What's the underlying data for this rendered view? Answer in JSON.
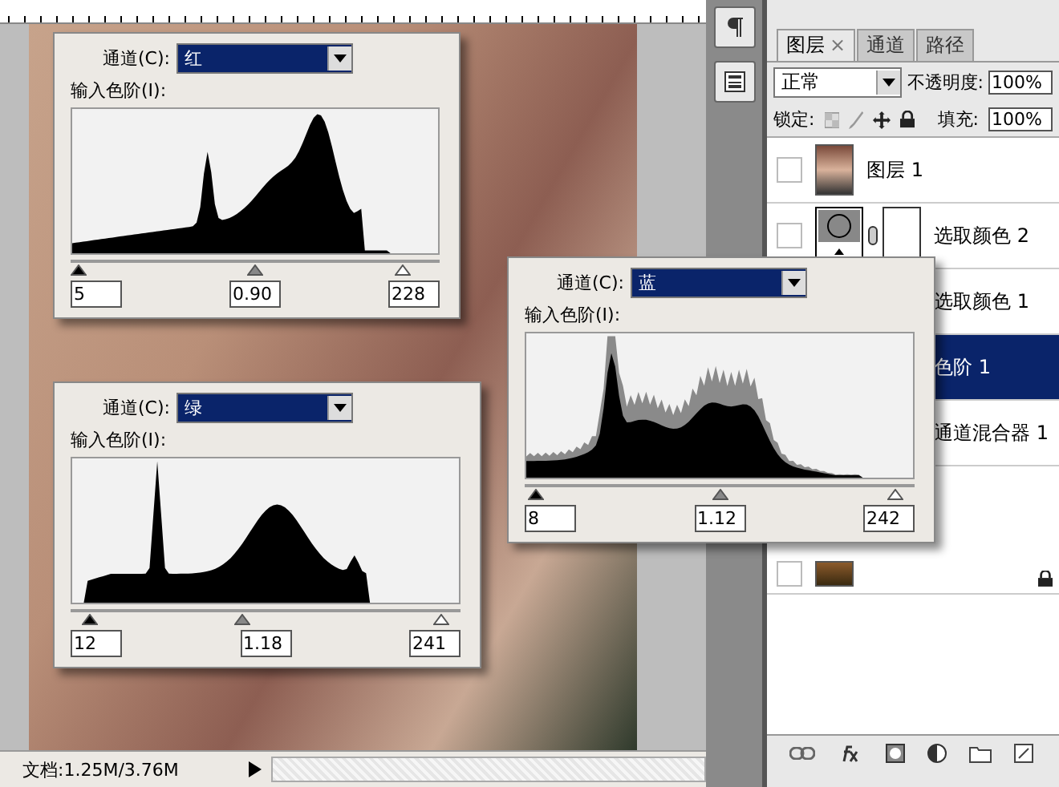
{
  "levels_dialogs": [
    {
      "kind": "red",
      "channel_label": "通道(C):",
      "channel": "红",
      "input_label": "输入色阶(I):",
      "black": "5",
      "gamma": "0.90",
      "white": "228",
      "sliders": [
        {
          "level": 0.02
        },
        {
          "level": 0.5
        },
        {
          "level": 0.9
        }
      ]
    },
    {
      "kind": "green",
      "channel_label": "通道(C):",
      "channel": "绿",
      "input_label": "输入色阶(I):",
      "black": "12",
      "gamma": "1.18",
      "white": "241",
      "sliders": [
        {
          "level": 0.05
        },
        {
          "level": 0.44
        },
        {
          "level": 0.95
        }
      ]
    },
    {
      "kind": "blue",
      "channel_label": "通道(C):",
      "channel": "蓝",
      "input_label": "输入色阶(I):",
      "black": "8",
      "gamma": "1.12",
      "white": "242",
      "sliders": [
        {
          "level": 0.03
        },
        {
          "level": 0.5
        },
        {
          "level": 0.95
        }
      ]
    }
  ],
  "layers_panel": {
    "tabs": [
      {
        "label": "图层",
        "close": "×",
        "selected": true
      },
      {
        "label": "通道",
        "selected": false
      },
      {
        "label": "路径",
        "selected": false
      }
    ],
    "blend_mode": "正常",
    "opacity_label": "不透明度:",
    "opacity": "100%",
    "lock_label": "锁定:",
    "fill_label": "填充:",
    "fill": "100%",
    "layers": [
      {
        "kind": "photo",
        "name": "图层 1",
        "selected": false
      },
      {
        "kind": "adjustment",
        "name": "选取颜色 2",
        "selected": false
      },
      {
        "kind": "adjustment",
        "name": "选取颜色 1",
        "selected": false
      },
      {
        "kind": "adjustment",
        "name": "色阶 1",
        "selected": true
      },
      {
        "kind": "adjustment",
        "name": "通道混合器 1",
        "selected": false
      },
      {
        "kind": "background",
        "locked": true,
        "selected": false
      }
    ]
  },
  "status_bar": {
    "document": "文档:1.25M/3.76M"
  }
}
